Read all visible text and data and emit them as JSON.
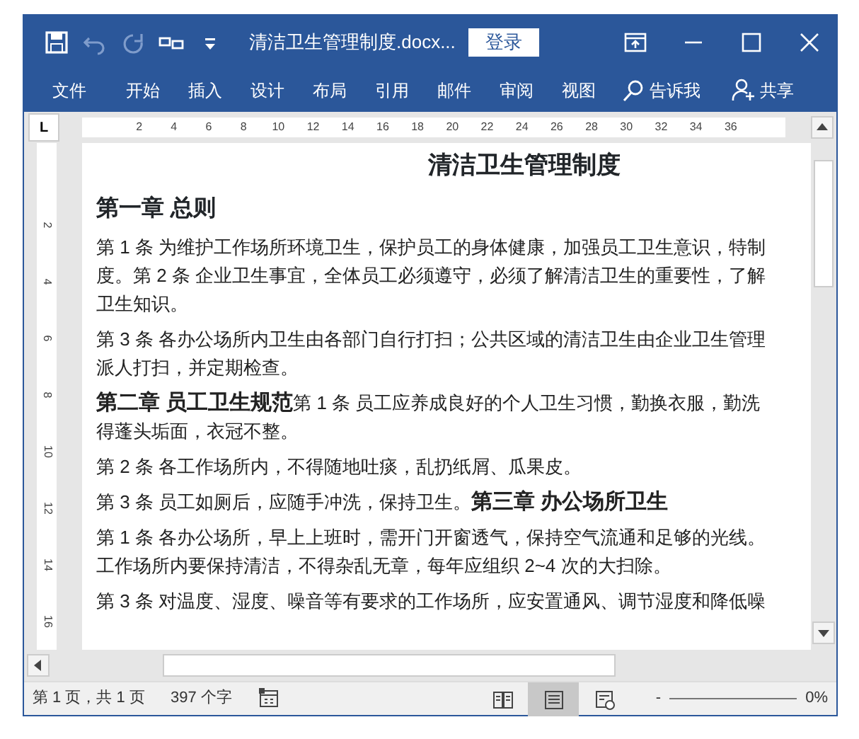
{
  "title_bar": {
    "title": "清洁卫生管理制度.docx...",
    "login_button": "登录",
    "quick_access": [
      {
        "kind": "save",
        "disabled": false
      },
      {
        "kind": "undo",
        "disabled": true
      },
      {
        "kind": "redo",
        "disabled": true
      },
      {
        "kind": "touch",
        "disabled": false
      },
      {
        "kind": "customize",
        "disabled": false
      }
    ]
  },
  "ribbon_tabs": [
    {
      "label": "文件"
    },
    {
      "label": "开始"
    },
    {
      "label": "插入"
    },
    {
      "label": "设计"
    },
    {
      "label": "布局"
    },
    {
      "label": "引用"
    },
    {
      "label": "邮件"
    },
    {
      "label": "审阅"
    },
    {
      "label": "视图"
    }
  ],
  "tell_me": "告诉我",
  "share": "共享",
  "ruler": {
    "tab_selector": "L",
    "ticks": [
      "2",
      "4",
      "6",
      "8",
      "10",
      "12",
      "14",
      "16",
      "18",
      "20",
      "22",
      "24",
      "26",
      "28",
      "30",
      "32",
      "34",
      "36"
    ],
    "vertical_ticks": [
      "2",
      "4",
      "6",
      "8",
      "10",
      "12",
      "14",
      "16"
    ]
  },
  "document": [
    {
      "kind": "title",
      "lines": [
        "清洁卫生管理制度"
      ]
    },
    {
      "kind": "heading",
      "lines": [
        "第一章 总则"
      ]
    },
    {
      "kind": "body",
      "lines": [
        "第 1 条 为维护工作场所环境卫生，保护员工的身体健康，加强员工卫生意识，特制",
        "度。第 2 条 企业卫生事宜，全体员工必须遵守，必须了解清洁卫生的重要性，了解",
        "卫生知识。"
      ]
    },
    {
      "kind": "body",
      "lines": [
        "第 3 条 各办公场所内卫生由各部门自行打扫；公共区域的清洁卫生由企业卫生管理",
        "派人打扫，并定期检查。"
      ]
    },
    {
      "kind": "body",
      "lines": [
        "**第二章 员工卫生规范**第 1 条 员工应养成良好的个人卫生习惯，勤换衣服，勤洗",
        "得蓬头垢面，衣冠不整。"
      ]
    },
    {
      "kind": "body",
      "lines": [
        "第 2 条 各工作场所内，不得随地吐痰，乱扔纸屑、瓜果皮。"
      ]
    },
    {
      "kind": "body",
      "lines": [
        "第 3 条 员工如厕后，应随手冲洗，保持卫生。**第三章 办公场所卫生**"
      ]
    },
    {
      "kind": "body",
      "lines": [
        "第 1 条 各办公场所，早上上班时，需开门开窗透气，保持空气流通和足够的光线。",
        "工作场所内要保持清洁，不得杂乱无章，每年应组织 2~4 次的大扫除。"
      ]
    },
    {
      "kind": "body",
      "lines": [
        "第 3 条 对温度、湿度、噪音等有要求的工作场所，应安置通风、调节湿度和降低噪"
      ]
    }
  ],
  "status_bar": {
    "page": "第 1 页，共 1 页",
    "word_count": "397 个字",
    "views": [
      {
        "kind": "read",
        "selected": false
      },
      {
        "kind": "print",
        "selected": true
      },
      {
        "kind": "web",
        "selected": false
      }
    ],
    "zoom_out": "-",
    "zoom": "0%"
  }
}
